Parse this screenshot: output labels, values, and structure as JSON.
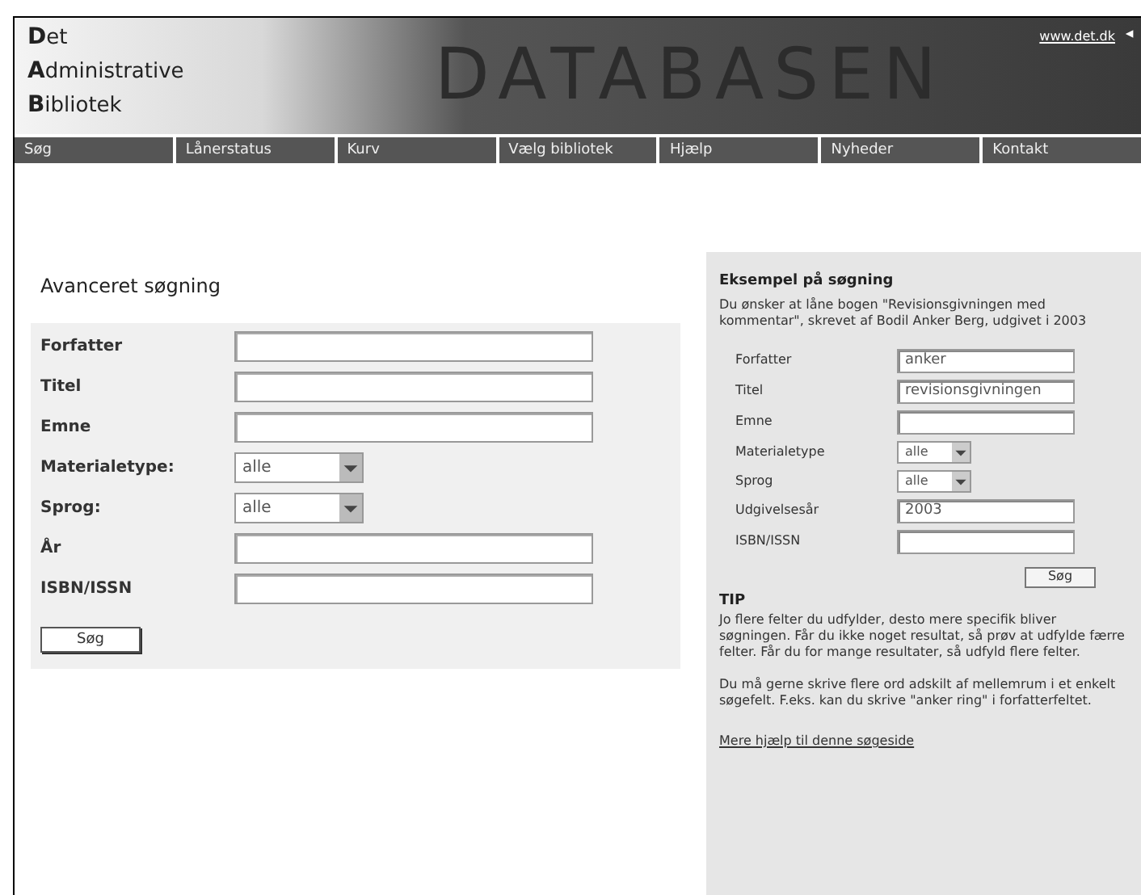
{
  "header": {
    "logo_lines": [
      "Det",
      "Administrative",
      "Bibliotek"
    ],
    "banner": "DATABASEN",
    "site_link": "www.det.dk"
  },
  "nav": [
    {
      "label": "Søg"
    },
    {
      "label": "Lånerstatus"
    },
    {
      "label": "Kurv"
    },
    {
      "label": "Vælg bibliotek"
    },
    {
      "label": "Hjælp"
    },
    {
      "label": "Nyheder"
    },
    {
      "label": "Kontakt"
    }
  ],
  "search_form": {
    "title": "Avanceret søgning",
    "fields": [
      {
        "kind": "text",
        "label": "Forfatter"
      },
      {
        "kind": "text",
        "label": "Titel"
      },
      {
        "kind": "text",
        "label": "Emne"
      },
      {
        "kind": "select",
        "label": "Materialetype:",
        "value": "alle"
      },
      {
        "kind": "select",
        "label": "Sprog:",
        "value": "alle"
      },
      {
        "kind": "text",
        "label": "År"
      },
      {
        "kind": "text",
        "label": "ISBN/ISSN"
      }
    ],
    "button": "Søg"
  },
  "example": {
    "title": "Eksempel på søgning",
    "intro": "Du ønsker at låne bogen \"Revisionsgivningen med kommentar\", skrevet af Bodil Anker Berg, udgivet i 2003",
    "fields": [
      {
        "kind": "text",
        "label": "Forfatter",
        "value": "anker"
      },
      {
        "kind": "text",
        "label": "Titel",
        "value": "revisionsgivningen"
      },
      {
        "kind": "text",
        "label": "Emne"
      },
      {
        "kind": "select",
        "label": "Materialetype",
        "value": "alle"
      },
      {
        "kind": "select",
        "label": "Sprog",
        "value": "alle"
      },
      {
        "kind": "text",
        "label": "Udgivelsesår",
        "value": "2003"
      },
      {
        "kind": "text",
        "label": "ISBN/ISSN"
      }
    ],
    "button": "Søg",
    "tip_title": "TIP",
    "tips": [
      "Jo flere felter du udfylder, desto mere specifik bliver søgningen. Får du ikke noget resultat, så prøv at udfylde færre felter. Får du for mange resultater, så udfyld flere felter.",
      "Du må gerne skrive flere ord adskilt af mellemrum i et enkelt søgefelt. F.eks. kan du skrive \"anker ring\" i forfatterfeltet."
    ],
    "link": "Mere hjælp til denne søgeside"
  }
}
